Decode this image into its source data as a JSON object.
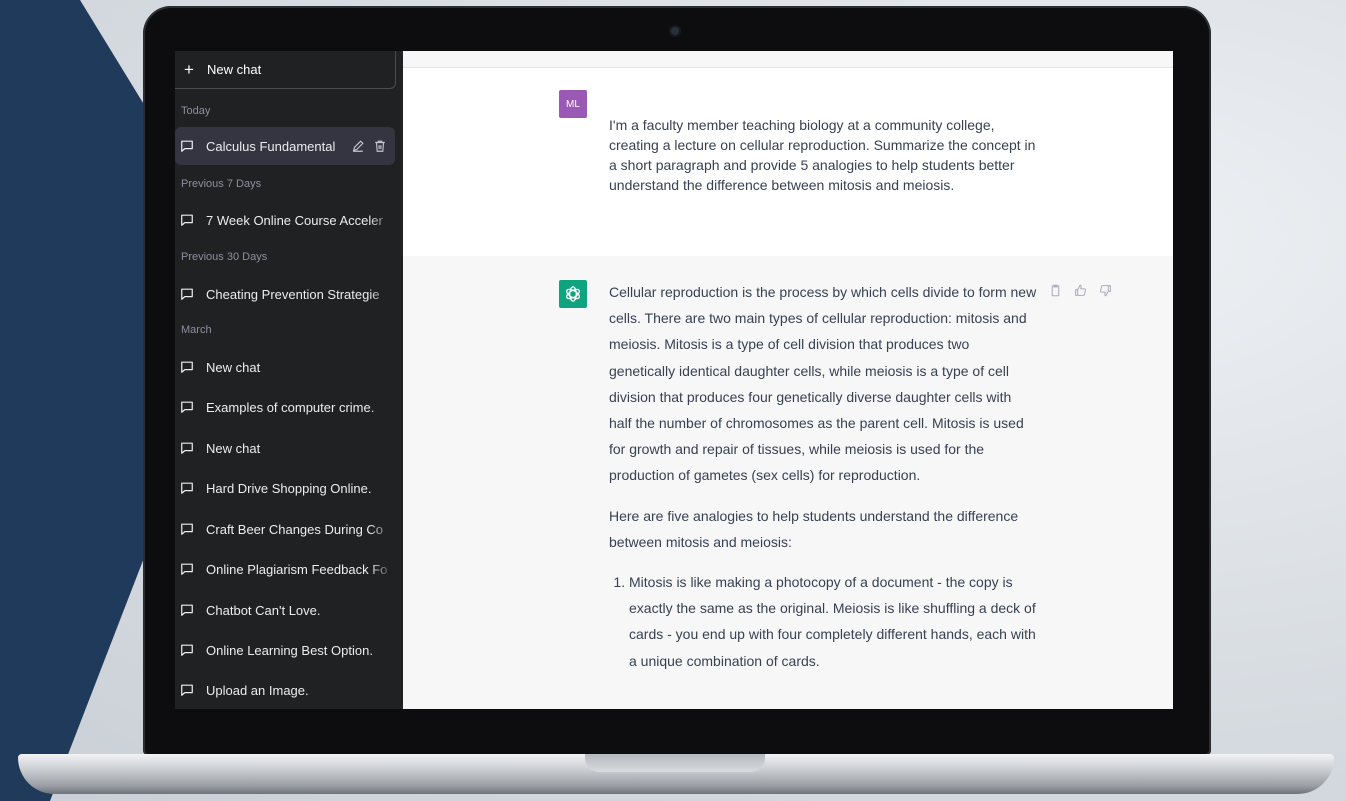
{
  "sidebar": {
    "new_chat_label": "New chat",
    "sections": [
      {
        "label": "Today"
      },
      {
        "label": "Previous 7 Days"
      },
      {
        "label": "Previous 30 Days"
      },
      {
        "label": "March"
      }
    ],
    "items": [
      {
        "label": "Calculus Fundamental",
        "active": true
      },
      {
        "label": "7 Week Online Course Acceler"
      },
      {
        "label": "Cheating Prevention Strategie"
      },
      {
        "label": "New chat"
      },
      {
        "label": "Examples of computer crime."
      },
      {
        "label": "New chat"
      },
      {
        "label": "Hard Drive Shopping Online."
      },
      {
        "label": "Craft Beer Changes During Co"
      },
      {
        "label": "Online Plagiarism Feedback Fo"
      },
      {
        "label": "Chatbot Can't Love."
      },
      {
        "label": "Online Learning Best Option."
      },
      {
        "label": "Upload an Image."
      }
    ]
  },
  "conversation": {
    "user": {
      "initials": "ML",
      "message": "I'm a faculty member teaching biology at a community college, creating a lecture on cellular reproduction. Summarize the concept in a short paragraph and provide 5 analogies to help students better understand the difference between mitosis and meiosis."
    },
    "assistant": {
      "paragraph1": "Cellular reproduction is the process by which cells divide to form new cells. There are two main types of cellular reproduction: mitosis and meiosis. Mitosis is a type of cell division that produces two genetically identical daughter cells, while meiosis is a type of cell division that produces four genetically diverse daughter cells with half the number of chromosomes as the parent cell. Mitosis is used for growth and repair of tissues, while meiosis is used for the production of gametes (sex cells) for reproduction.",
      "paragraph2": "Here are five analogies to help students understand the difference between mitosis and meiosis:",
      "analogies": [
        "Mitosis is like making a photocopy of a document - the copy is exactly the same as the original. Meiosis is like shuffling a deck of cards - you end up with four completely different hands, each with a unique combination of cards."
      ]
    }
  },
  "icons": {
    "chat": "chat-bubble-icon",
    "edit": "pencil-icon",
    "delete": "trash-icon",
    "copy": "clipboard-icon",
    "like": "thumbs-up-icon",
    "dislike": "thumbs-down-icon",
    "assistant": "openai-logo-icon"
  },
  "colors": {
    "sidebar_bg": "#202123",
    "user_avatar": "#9b59b6",
    "assistant_avatar": "#10a37f",
    "background_wedge": "#1f3a5a"
  }
}
